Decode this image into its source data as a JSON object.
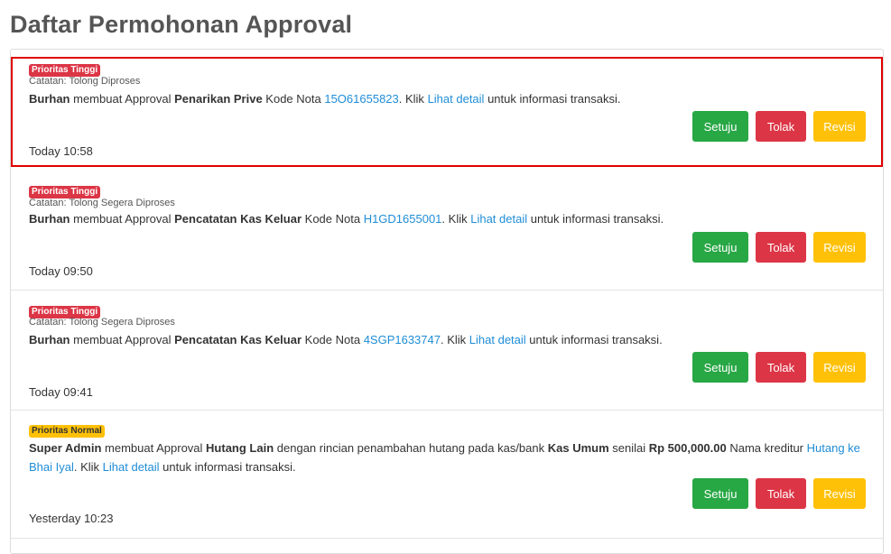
{
  "page_title": "Daftar Permohonan Approval",
  "buttons": {
    "approve": "Setuju",
    "reject": "Tolak",
    "revise": "Revisi"
  },
  "colors": {
    "approve": "#28a745",
    "reject": "#dc3545",
    "revise": "#ffc107",
    "link": "#1f8dd6",
    "highlight": "#e00000"
  },
  "items": [
    {
      "priority": "Prioritas Tinggi",
      "note": "Catatan: Tolong Diproses",
      "actor": "Burhan",
      "verb": " membuat Approval ",
      "type": "Penarikan Prive",
      "code_label": " Kode Nota ",
      "code": "15O61655823",
      "klik": ". Klik ",
      "detail": "Lihat detail",
      "tail": " untuk informasi transaksi.",
      "time": "Today 10:58"
    },
    {
      "priority": "Prioritas Tinggi",
      "note": "Catatan: Tolong Segera Diproses",
      "actor": "Burhan",
      "verb": " membuat Approval ",
      "type": "Pencatatan Kas Keluar",
      "code_label": " Kode Nota ",
      "code": "H1GD1655001",
      "klik": ". Klik ",
      "detail": "Lihat detail",
      "tail": " untuk informasi transaksi.",
      "time": "Today 09:50"
    },
    {
      "priority": "Prioritas Tinggi",
      "note": "Catatan: Tolong Segera Diproses",
      "actor": "Burhan",
      "verb": " membuat Approval ",
      "type": "Pencatatan Kas Keluar",
      "code_label": " Kode Nota ",
      "code": "4SGP1633747",
      "klik": ". Klik ",
      "detail": "Lihat detail",
      "tail": " untuk informasi transaksi.",
      "time": "Today 09:41"
    },
    {
      "priority": "Prioritas Normal",
      "actor": "Super Admin",
      "verb": " membuat Approval ",
      "type": "Hutang Lain",
      "mid1": " dengan rincian penambahan hutang pada kas/bank ",
      "bank": "Kas Umum",
      "mid2": " senilai ",
      "amount": "Rp 500,000.00",
      "mid3": " Nama kreditur ",
      "creditor": "Hutang ke Bhai Iyal",
      "klik": ". Klik ",
      "detail": "Lihat detail",
      "tail": " untuk informasi transaksi.",
      "time": "Yesterday 10:23"
    }
  ]
}
